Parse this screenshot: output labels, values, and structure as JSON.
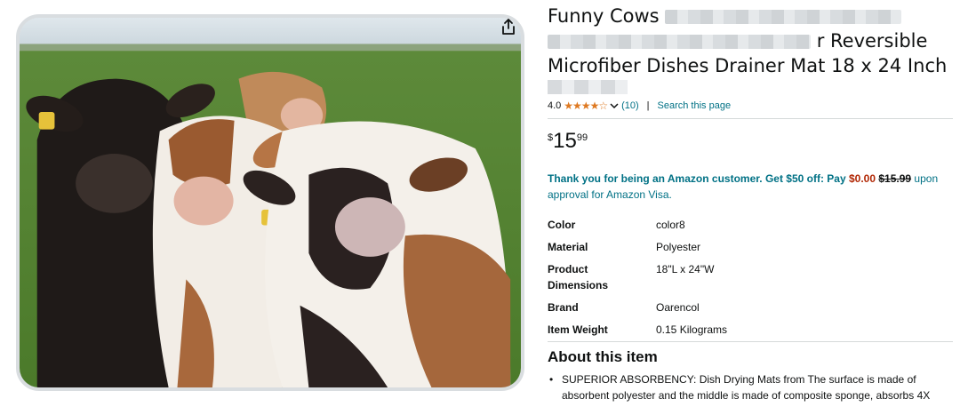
{
  "product": {
    "title_lines": [
      "Funny Cows",
      "r Reversible",
      "Microfiber Dishes Drainer Mat 18 x 24 Inch"
    ],
    "rating": "4.0",
    "stars": "★★★★☆",
    "review_count": "(10)",
    "search_link": "Search this page",
    "price": {
      "symbol": "$",
      "whole": "15",
      "fraction": "99"
    }
  },
  "promo": {
    "lead": "Thank you for being an Amazon customer.",
    "offer": "Get $50 off:",
    "pay": "Pay",
    "new_price": "$0.00",
    "old_price": "$15.99",
    "tail": "upon approval for Amazon Visa."
  },
  "specs": [
    {
      "key": "Color",
      "value": "color8"
    },
    {
      "key": "Material",
      "value": "Polyester"
    },
    {
      "key": "Product Dimensions",
      "value": "18\"L x 24\"W"
    },
    {
      "key": "Brand",
      "value": "Oarencol"
    },
    {
      "key": "Item Weight",
      "value": "0.15 Kilograms"
    }
  ],
  "about": {
    "title": "About this item",
    "bullet": "SUPERIOR ABSORBENCY: Dish Drying Mats from The surface is made of absorbent polyester and the middle is made of composite sponge, absorbs 4X"
  },
  "icons": {
    "share": "share-icon",
    "dropdown": "chevron-down-icon"
  },
  "colors": {
    "link": "#007185",
    "star": "#de7921",
    "price_red": "#b12704"
  }
}
